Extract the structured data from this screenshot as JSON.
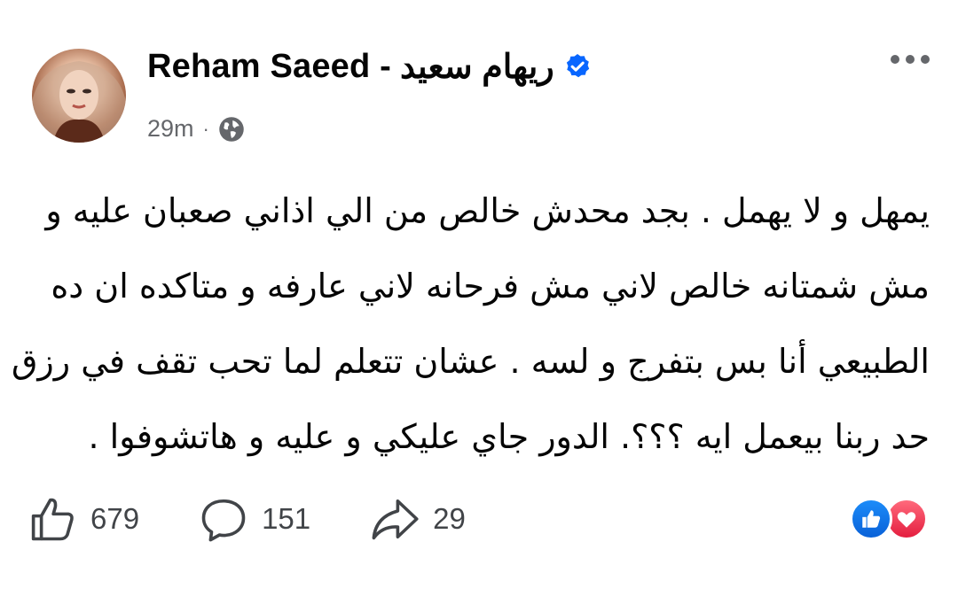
{
  "post": {
    "author": {
      "name_latin": "Reham Saeed -",
      "name_arabic": "ريهام سعيد",
      "verified": true,
      "avatar_icon": "profile-photo"
    },
    "time": "29m",
    "separator": "·",
    "audience_icon": "globe-icon",
    "text_lines": [
      "يمهل و لا يهمل . بجد محدش خالص من الي اذاني صعبان عليه و",
      "مش شمتانه خالص  لاني مش فرحانه لاني عارفه و متاكده ان ده",
      "الطبيعي أنا بس بتفرج و لسه . عشان تتعلم لما تحب تقف في رزق",
      "حد ربنا بيعمل ايه ؟؟؟. الدور جاي عليكي و عليه و هاتشوفوا ."
    ],
    "likes": "679",
    "comments": "151",
    "shares": "29",
    "reactions": [
      "like-reaction",
      "love-reaction"
    ],
    "colors": {
      "verified_blue": "#0866ff",
      "meta_gray": "#65676b",
      "action_gray": "#414448",
      "like_blue": "#1877f2",
      "love_red": "#f33e58"
    }
  }
}
